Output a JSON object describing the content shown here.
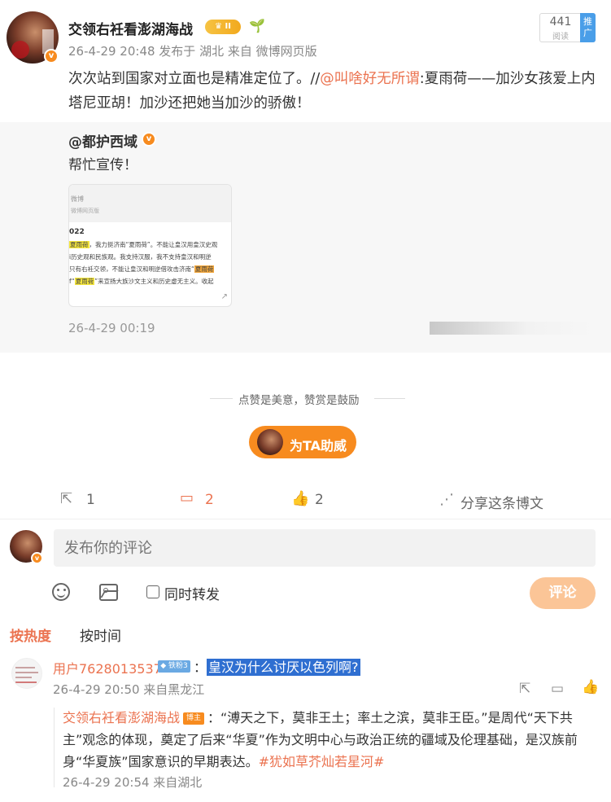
{
  "post": {
    "author": "交领右衽看澎湖海战",
    "level_badge": "II",
    "meta": "26-4-29 20:48  发布于 湖北  来自 微博网页版",
    "read_count": "441",
    "read_label": "阅读",
    "promote_label": "推广",
    "text_before": "次次站到国家对立面也是精准定位了。//",
    "mention": "@叫啥好无所谓",
    "text_after": ":夏雨荷——加沙女孩爱上内塔尼亚胡！加沙还把她当加沙的骄傲！"
  },
  "quote": {
    "author": "@都护西域",
    "text": "帮忙宣传！",
    "time": "26-4-29 00:19",
    "image": {
      "line1": "微博",
      "line2": "微博网页版",
      "line3": "022",
      "rows": [
        {
          "pre": "",
          "hl": "夏雨荷",
          "post": "，我力挺济南“夏雨荷”。不能让皇汉用皇汉史观"
        },
        {
          "pre": "i历史观和民族观。我支持汉服，我不支持皇汉和明逆",
          "hl": "",
          "post": ""
        },
        {
          "pre": "只有右衽交领，不能让皇汉和明逆借攻击济南“",
          "hl": "夏雨荷",
          "post": ""
        },
        {
          "pre": "f“",
          "hl": "夏雨荷",
          "post": "”来宣扬大族沙文主义和历史虚无主义。收起"
        }
      ]
    }
  },
  "appreciation": {
    "text": "点赞是美意，赞赏是鼓励",
    "boost_label": "为TA助威"
  },
  "actions": {
    "repost": "1",
    "comment": "2",
    "like": "2",
    "share": "分享这条博文"
  },
  "composer": {
    "placeholder": "发布你的评论",
    "repost_label": "同时转发",
    "submit_label": "评论"
  },
  "sort": {
    "hot": "按热度",
    "time": "按时间"
  },
  "comment": {
    "user": "用户7628013537",
    "badge": "铁粉3",
    "colon": "：",
    "text": "皇汉为什么讨厌以色列啊?",
    "time": "26-4-29 20:50 来自黑龙江",
    "reply": {
      "user": "交领右衽看澎湖海战",
      "badge": "博主",
      "text": "：“溥天之下，莫非王土；率土之滨，莫非王臣。”是周代“天下共主”观念的体现，奠定了后来“华夏”作为文明中心与政治正统的疆域及伦理基础，是汉族前身“华夏族”国家意识的早期表达。",
      "tag": "#犹如草芥灿若星河#",
      "time": "26-4-29 20:54 来自湖北"
    }
  }
}
